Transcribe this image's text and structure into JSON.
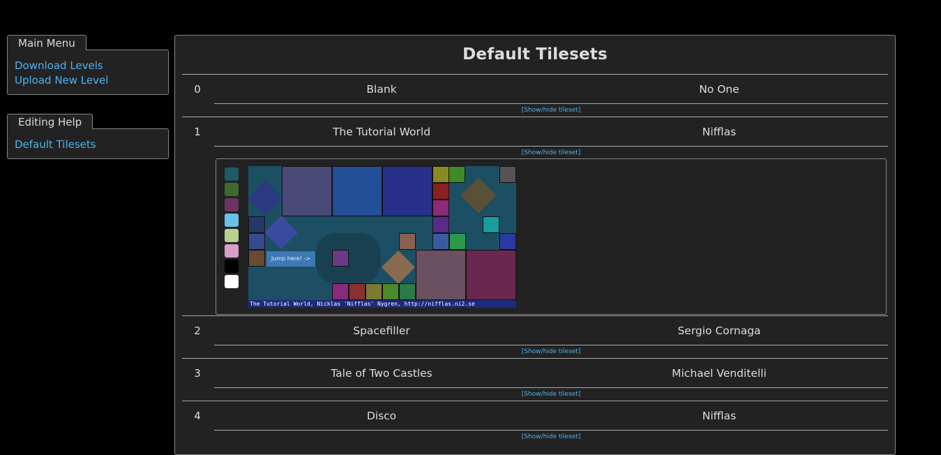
{
  "sidebar": {
    "main_menu": {
      "title": "Main Menu",
      "links": [
        "Download Levels",
        "Upload New Level"
      ]
    },
    "editing_help": {
      "title": "Editing Help",
      "links": [
        "Default Tilesets"
      ]
    }
  },
  "main": {
    "title": "Default Tilesets",
    "toggle_label": "[Show/hide tileset]",
    "rows": [
      {
        "num": "0",
        "name": "Blank",
        "author": "No One"
      },
      {
        "num": "1",
        "name": "The Tutorial World",
        "author": "Nifflas"
      },
      {
        "num": "2",
        "name": "Spacefiller",
        "author": "Sergio Cornaga"
      },
      {
        "num": "3",
        "name": "Tale of Two Castles",
        "author": "Michael Venditelli"
      },
      {
        "num": "4",
        "name": "Disco",
        "author": "Nifflas"
      }
    ],
    "preview": {
      "caption": "The Tutorial World, Nicklas 'Nifflas' Nygren, http://nifflas.ni2.se",
      "jump_text": "Jump here! ->",
      "swatch_colors": [
        "#1e5a68",
        "#3f6a2c",
        "#6a3560",
        "#6ac0e6",
        "#b8d08e",
        "#d8a0c8",
        "#000000",
        "#ffffff"
      ]
    }
  }
}
